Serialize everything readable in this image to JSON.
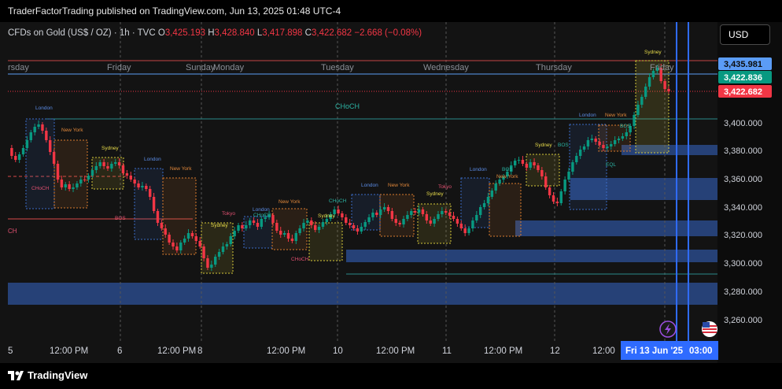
{
  "header": {
    "publish_line": "TraderFactorTrading published on TradingView.com, Jun 13, 2025 01:48 UTC-4"
  },
  "legend": {
    "symbol": "CFDs on Gold (US$ / OZ) · 1h · TVC",
    "open_label": "O",
    "open": "3,425.193",
    "high_label": "H",
    "high": "3,428.840",
    "low_label": "L",
    "low": "3,417.898",
    "close_label": "C",
    "close": "3,422.682",
    "change": "−2.668 (−0.08%)"
  },
  "currency_button": "USD",
  "price_axis": {
    "ticks": [
      "3,400.000",
      "3,380.000",
      "3,360.000",
      "3,340.000",
      "3,320.000",
      "3,300.000",
      "3,280.000",
      "3,260.000"
    ],
    "badges": [
      {
        "label": "3,435.981",
        "color": "#5b9cf6"
      },
      {
        "label": "3,422.836",
        "color": "#089981"
      },
      {
        "label": "3,422.682",
        "color": "#f23645"
      }
    ]
  },
  "time_axis": {
    "ticks": [
      "5",
      "12:00 PM",
      "6",
      "12:00 PM",
      "8",
      "12:00 PM",
      "10",
      "12:00 PM",
      "11",
      "12:00 PM",
      "12",
      "12:00"
    ],
    "current": "Fri 13 Jun '25",
    "current_time": "03:00"
  },
  "day_labels": [
    "rsday",
    "Friday",
    "Sunday",
    "Monday",
    "Tuesday",
    "Wednesday",
    "Thursday",
    "Friday"
  ],
  "annotations": {
    "choch_top": "CHoCH",
    "sessions": [
      "London",
      "New York",
      "Sydney",
      "Tokyo"
    ],
    "bos": "BOS",
    "choch": "CHoCH",
    "eql": "EQL",
    "left_cut": "CH"
  },
  "footer": {
    "brand": "TradingView"
  },
  "colors": {
    "bull": "#089981",
    "bear": "#f23645",
    "zone": "#2a4a8a",
    "london": "#3b6cc7",
    "newyork": "#d97b2e",
    "sydney": "#d6c93a",
    "tokyo": "#d24a6a"
  },
  "icons": [
    "flash-icon",
    "us-flag-icon",
    "tradingview-logo-icon"
  ]
}
